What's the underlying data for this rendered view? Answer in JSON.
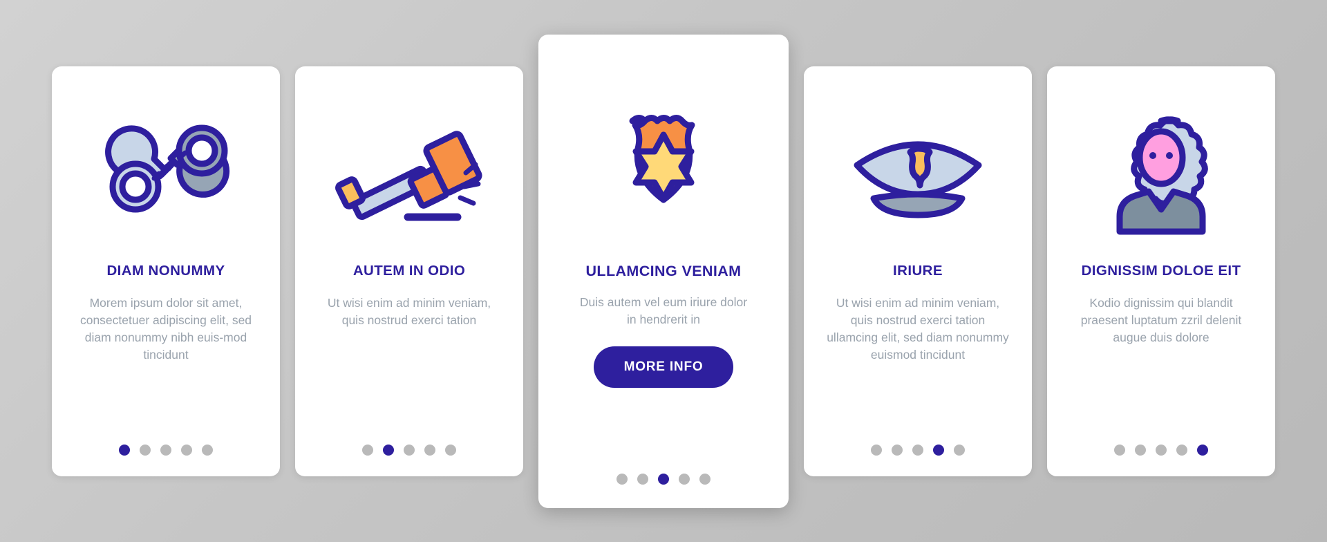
{
  "palette": {
    "background_start": "#d2d2d2",
    "background_end": "#b9b9b9",
    "card_bg": "#ffffff",
    "accent_indigo": "#2e1f9e",
    "body_text_gray": "#9aa3ad",
    "dot_inactive": "#b9b9b9",
    "icon_outline": "#2e1f9e",
    "icon_orange": "#f79045",
    "icon_orange_light": "#fbbe5c",
    "icon_yellow": "#ffd978",
    "icon_blue_light": "#c8d6e8",
    "icon_blue_gray": "#96a5b5",
    "icon_pink": "#ff9fe0"
  },
  "cards": [
    {
      "icon_name": "handcuffs-icon",
      "title": "DIAM NONUMMY",
      "body": "Morem ipsum dolor sit amet, consectetuer adipiscing elit, sed diam nonummy nibh euis-mod tincidunt",
      "featured": false,
      "dots": {
        "count": 5,
        "active_index": 0
      }
    },
    {
      "icon_name": "gavel-icon",
      "title": "AUTEM IN ODIO",
      "body": "Ut wisi enim ad minim veniam, quis nostrud exerci tation",
      "featured": false,
      "dots": {
        "count": 5,
        "active_index": 1
      }
    },
    {
      "icon_name": "police-badge-shield-icon",
      "title": "ULLAMCING VENIAM",
      "body": "Duis autem vel eum iriure dolor in hendrerit in",
      "featured": true,
      "cta_label": "MORE INFO",
      "dots": {
        "count": 5,
        "active_index": 2
      }
    },
    {
      "icon_name": "police-cap-icon",
      "title": "IRIURE",
      "body": "Ut wisi enim ad minim veniam, quis nostrud exerci tation ullamcing elit, sed diam nonummy euismod tincidunt",
      "featured": false,
      "dots": {
        "count": 5,
        "active_index": 3
      }
    },
    {
      "icon_name": "judge-wig-icon",
      "title": "DIGNISSIM DOLOE EIT",
      "body": "Kodio dignissim qui blandit praesent luptatum zzril delenit augue duis dolore",
      "featured": false,
      "dots": {
        "count": 5,
        "active_index": 4
      }
    }
  ]
}
